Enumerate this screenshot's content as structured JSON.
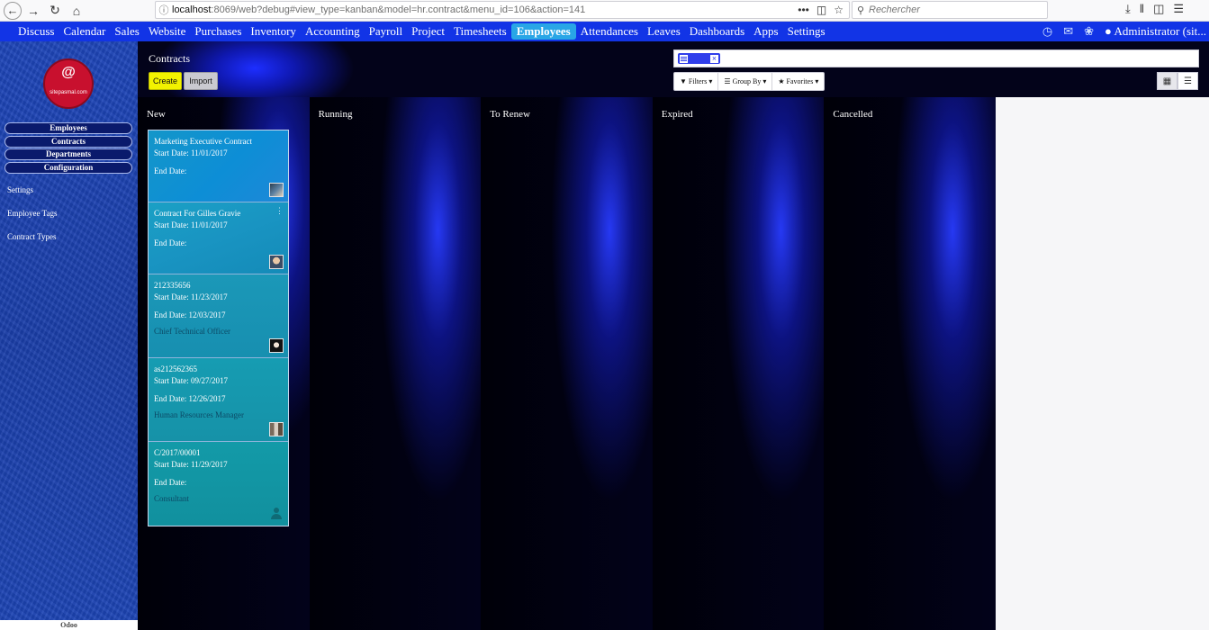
{
  "browser": {
    "url_host": "localhost",
    "url_rest": ":8069/web?debug#view_type=kanban&model=hr.contract&menu_id=106&action=141",
    "search_placeholder": "Rechercher",
    "url_more": "•••"
  },
  "topmenu": {
    "items": [
      "Discuss",
      "Calendar",
      "Sales",
      "Website",
      "Purchases",
      "Inventory",
      "Accounting",
      "Payroll",
      "Project",
      "Timesheets",
      "Employees",
      "Attendances",
      "Leaves",
      "Dashboards",
      "Apps",
      "Settings"
    ],
    "active": "Employees",
    "user": "Administrator (sit..."
  },
  "sidebar": {
    "logo_text": "sitepasmal.com",
    "menu": [
      "Employees",
      "Contracts",
      "Departments",
      "Configuration"
    ],
    "links": [
      "Settings",
      "Employee Tags",
      "Contract Types"
    ],
    "footer": "Odoo"
  },
  "control_panel": {
    "title": "Contracts",
    "create_label": "Create",
    "import_label": "Import",
    "facet_value": "",
    "filters_label": "Filters",
    "groupby_label": "Group By",
    "favorites_label": "Favorites"
  },
  "kanban": {
    "columns": [
      "New",
      "Running",
      "To Renew",
      "Expired",
      "Cancelled"
    ],
    "cards": [
      {
        "name": "Marketing Executive Contract",
        "start": "Start Date: 11/01/2017",
        "end": "End Date:",
        "job": ""
      },
      {
        "name": "Contract For Gilles Gravie",
        "start": "Start Date: 11/01/2017",
        "end": "End Date:",
        "job": ""
      },
      {
        "name": "212335656",
        "start": "Start Date: 11/23/2017",
        "end": "End Date: 12/03/2017",
        "job": "Chief Technical Officer"
      },
      {
        "name": "as212562365",
        "start": "Start Date: 09/27/2017",
        "end": "End Date: 12/26/2017",
        "job": "Human Resources Manager"
      },
      {
        "name": "C/2017/00001",
        "start": "Start Date: 11/29/2017",
        "end": "End Date:",
        "job": "Consultant"
      }
    ]
  },
  "colors": {
    "topmenu_bg": "#1234e6",
    "active_app": "#29a6e6",
    "create_button": "#f2f200",
    "card_bg": "#1496c9"
  }
}
